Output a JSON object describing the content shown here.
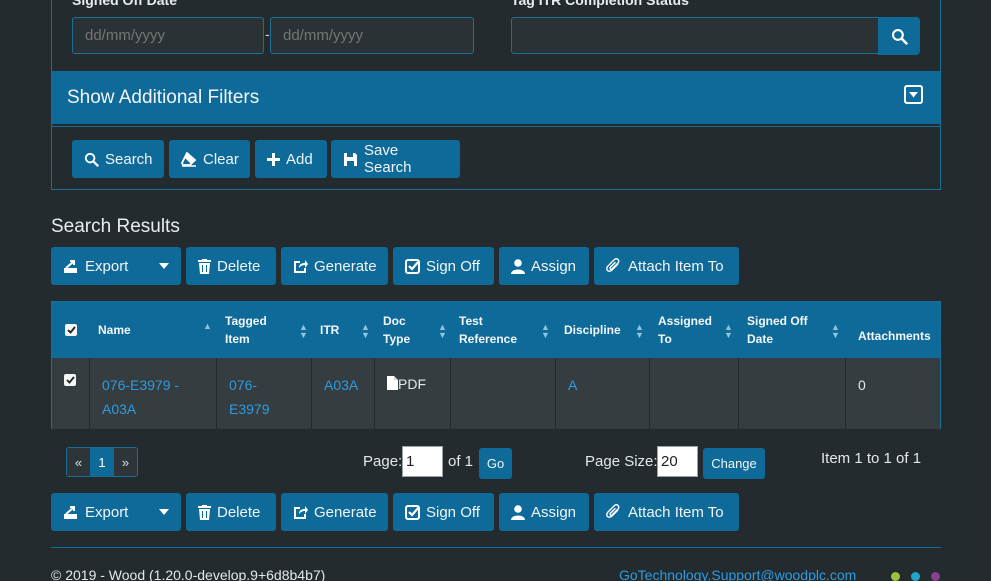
{
  "filters": {
    "signed_off_label": "Signed Off Date",
    "from_placeholder": "dd/mm/yyyy",
    "dash": "-",
    "to_placeholder": "dd/mm/yyyy",
    "tag_itr_label": "Tag ITR Completion Status",
    "tag_itr_value": "",
    "additional_filters": "Show Additional Filters",
    "buttons": {
      "search": "Search",
      "clear": "Clear",
      "add": "Add",
      "save_search": "Save Search"
    }
  },
  "results": {
    "title": "Search Results",
    "actions": {
      "export": "Export",
      "delete": "Delete",
      "generate": "Generate",
      "sign_off": "Sign Off",
      "assign": "Assign",
      "attach": "Attach Item To"
    },
    "columns": {
      "name": "Name",
      "tagged_item_1": "Tagged",
      "tagged_item_2": "Item",
      "itr": "ITR",
      "doc_type_1": "Doc",
      "doc_type_2": "Type",
      "test_ref_1": "Test",
      "test_ref_2": "Reference",
      "discipline": "Discipline",
      "assigned_1": "Assigned",
      "assigned_2": "To",
      "signed_off_1": "Signed Off",
      "signed_off_2": "Date",
      "attachments": "Attachments"
    },
    "rows": [
      {
        "name_1": "076-E3979 -",
        "name_2": "A03A",
        "tagged_1": "076-",
        "tagged_2": "E3979",
        "itr": "A03A",
        "doc_type": "PDF",
        "test_reference": "",
        "discipline": "A",
        "assigned_to": "",
        "signed_off_date": "",
        "attachments": "0"
      }
    ]
  },
  "pagination": {
    "prev": "«",
    "current": "1",
    "next": "»",
    "page_label": "Page:",
    "page_value": "1",
    "of_label": "of 1",
    "go": "Go",
    "size_label": "Page Size:",
    "size_value": "20",
    "change": "Change",
    "summary": "Item 1 to 1 of 1"
  },
  "footer": {
    "copyright": "© 2019 - Wood (1.20.0-develop.9+6d8b4b7)",
    "support_email": "GoTechnology.Support@woodplc.com"
  },
  "colors": {
    "primary": "#0e6a99",
    "background": "#242b2e",
    "link": "#2d9be0",
    "dot1": "#9ac43c",
    "dot2": "#1fa7c9",
    "dot3": "#8d3f8f"
  }
}
